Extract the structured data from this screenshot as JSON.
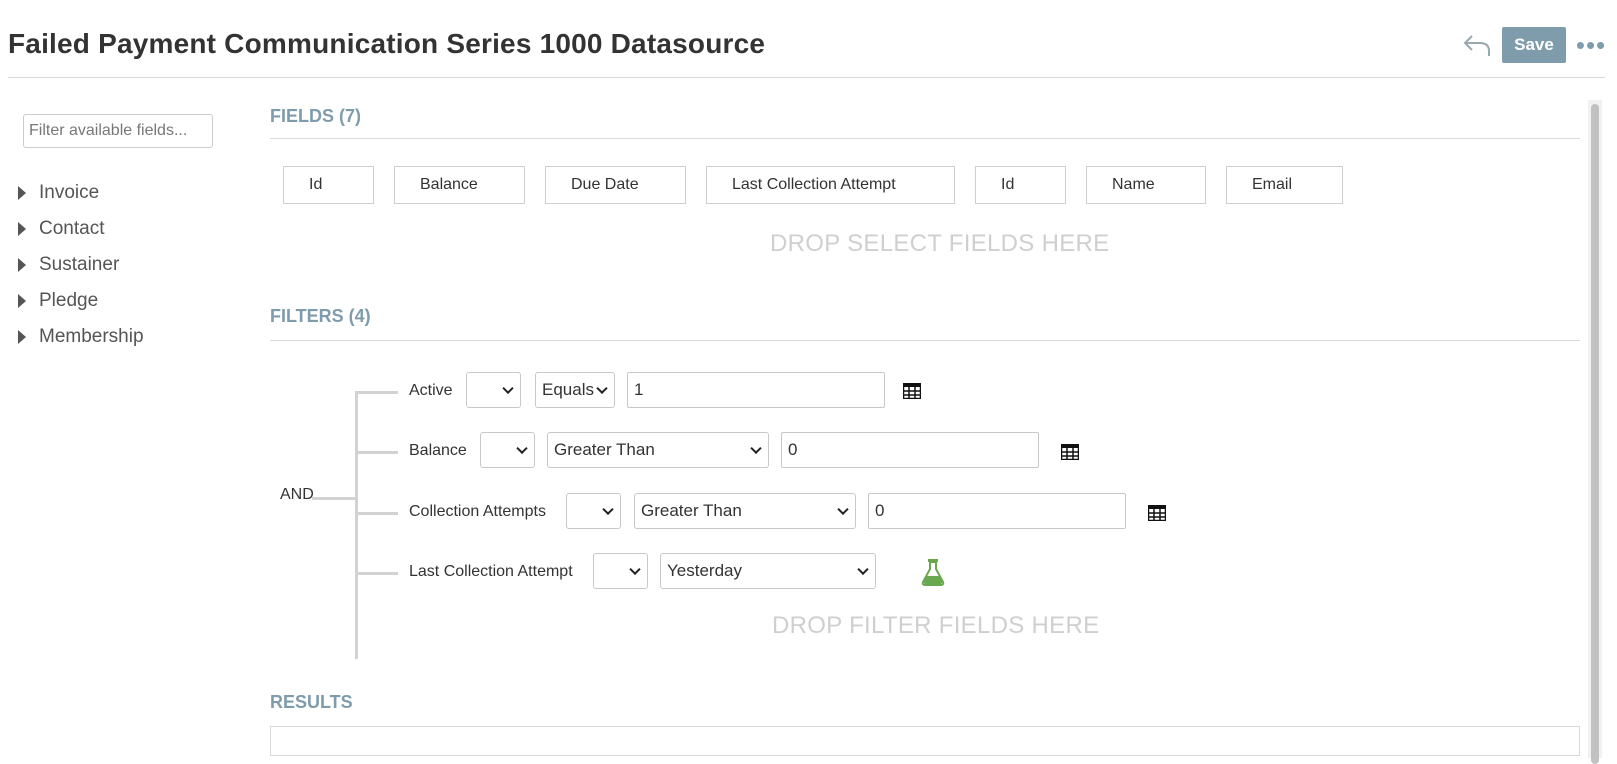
{
  "header": {
    "title": "Failed Payment Communication Series 1000 Datasource",
    "save_label": "Save",
    "undo_icon": "undo-arrow-icon",
    "more_icon": "ellipsis-icon",
    "more_glyph": "•••"
  },
  "sidebar": {
    "filter_placeholder": "Filter available fields...",
    "items": [
      {
        "label": "Invoice"
      },
      {
        "label": "Contact"
      },
      {
        "label": "Sustainer"
      },
      {
        "label": "Pledge"
      },
      {
        "label": "Membership"
      }
    ]
  },
  "fields": {
    "title": "FIELDS (7)",
    "items": [
      {
        "label": "Id"
      },
      {
        "label": "Balance"
      },
      {
        "label": "Due Date"
      },
      {
        "label": "Last Collection Attempt"
      },
      {
        "label": "Id"
      },
      {
        "label": "Name"
      },
      {
        "label": "Email"
      }
    ],
    "drop_text": "DROP SELECT FIELDS HERE"
  },
  "filters": {
    "title": "FILTERS (4)",
    "conjunction": "AND",
    "rows": [
      {
        "field": "Active",
        "modifier": "",
        "operator": "Equals",
        "value": "1",
        "icon": "table-grid-icon"
      },
      {
        "field": "Balance",
        "modifier": "",
        "operator": "Greater Than",
        "value": "0",
        "icon": "table-grid-icon"
      },
      {
        "field": "Collection Attempts",
        "modifier": "",
        "operator": "Greater Than",
        "value": "0",
        "icon": "table-grid-icon"
      },
      {
        "field": "Last Collection Attempt",
        "modifier": "",
        "operator": "Yesterday",
        "icon": "flask-icon"
      }
    ],
    "drop_text": "DROP FILTER FIELDS HERE"
  },
  "results": {
    "title": "RESULTS"
  },
  "colors": {
    "accent": "#7e9cac",
    "flask": "#6aa84f",
    "drop_text": "#cfcfcf"
  }
}
